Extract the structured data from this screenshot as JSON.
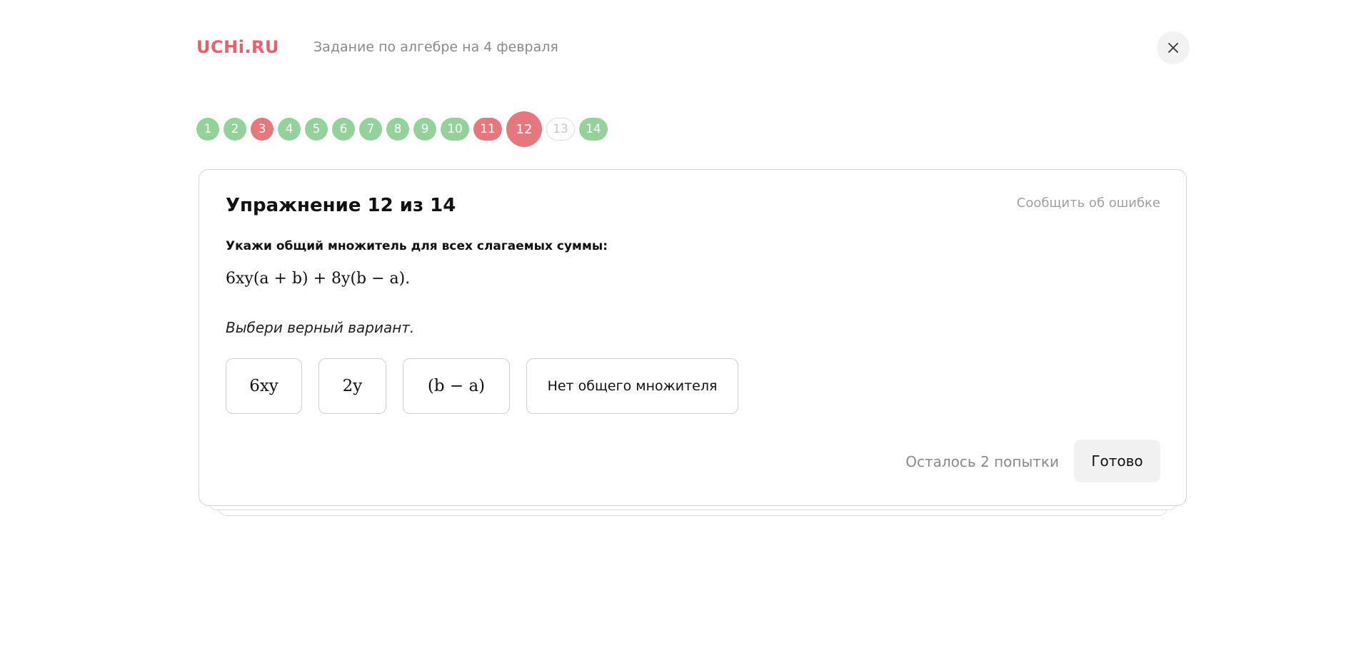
{
  "header": {
    "logo": "UCHi.RU",
    "title": "Задание по алгебре на 4 февраля",
    "close_icon": "close-icon"
  },
  "progress": {
    "steps": [
      {
        "label": "1",
        "status": "correct"
      },
      {
        "label": "2",
        "status": "correct"
      },
      {
        "label": "3",
        "status": "wrong"
      },
      {
        "label": "4",
        "status": "correct"
      },
      {
        "label": "5",
        "status": "correct"
      },
      {
        "label": "6",
        "status": "correct"
      },
      {
        "label": "7",
        "status": "correct"
      },
      {
        "label": "8",
        "status": "correct"
      },
      {
        "label": "9",
        "status": "correct"
      },
      {
        "label": "10",
        "status": "correct"
      },
      {
        "label": "11",
        "status": "wrong"
      },
      {
        "label": "12",
        "status": "current"
      },
      {
        "label": "13",
        "status": "pending"
      },
      {
        "label": "14",
        "status": "correct"
      }
    ]
  },
  "card": {
    "title": "Упражнение 12 из 14",
    "report_link": "Сообщить об ошибке",
    "task": "Укажи общий множитель для всех слагаемых суммы:",
    "formula": "6xy(a + b) + 8y(b − a).",
    "hint": "Выбери верный вариант.",
    "options": [
      "6xy",
      "2y",
      "(b − a)",
      "Нет общего множителя"
    ],
    "attempts": "Осталось 2 попытки",
    "done_label": "Готово"
  },
  "colors": {
    "brand": "#e8606a",
    "correct": "#94d19b",
    "wrong": "#e6777c"
  }
}
